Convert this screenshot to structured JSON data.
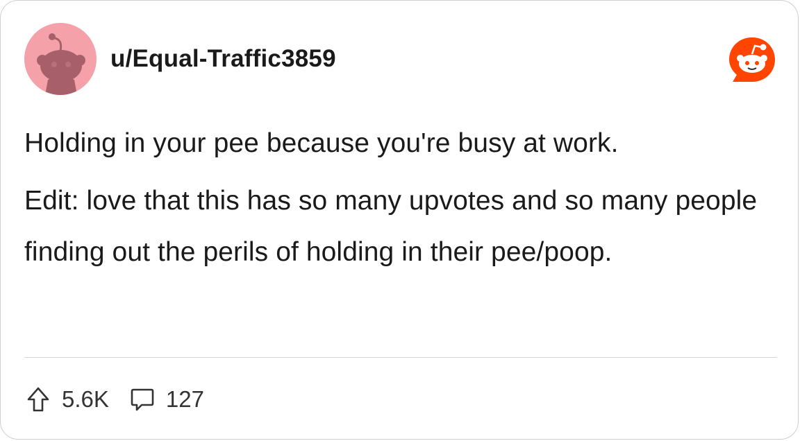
{
  "post": {
    "username": "u/Equal-Traffic3859",
    "title": "Holding in your pee because you're busy at work.",
    "edit": "Edit: love that this has so many upvotes and so many people finding out the perils of holding in their pee/poop."
  },
  "stats": {
    "upvotes": "5.6K",
    "comments": "127"
  },
  "icons": {
    "avatar": "reddit-snoo-avatar",
    "brand": "reddit-logo-icon",
    "upvote": "upvote-arrow-icon",
    "comment": "comment-bubble-icon"
  },
  "colors": {
    "avatar_bg": "#f4a1a9",
    "avatar_figure": "#a7606a",
    "brand": "#ff4500",
    "text": "#1a1a1a"
  }
}
